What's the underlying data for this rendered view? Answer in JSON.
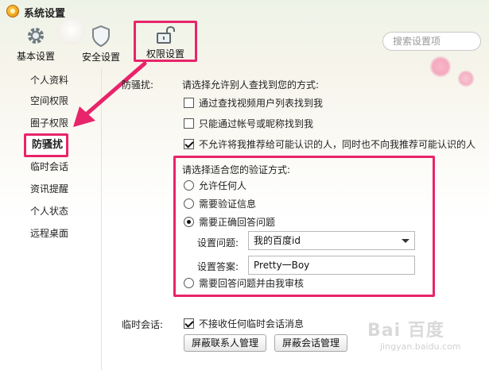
{
  "window": {
    "title": "系统设置"
  },
  "toolbar": {
    "basic_label": "基本设置",
    "security_label": "安全设置",
    "permission_label": "权限设置"
  },
  "search": {
    "placeholder": "搜索设置项"
  },
  "sidebar": {
    "items": [
      {
        "label": "个人资料"
      },
      {
        "label": "空间权限"
      },
      {
        "label": "圈子权限"
      },
      {
        "label": "防骚扰"
      },
      {
        "label": "临时会话"
      },
      {
        "label": "资讯提醒"
      },
      {
        "label": "个人状态"
      },
      {
        "label": "远程桌面"
      }
    ]
  },
  "anti_harass": {
    "section_label": "防骚扰:",
    "prompt": "请选择允许别人查找到您的方式:",
    "options": [
      {
        "label": "通过查找视频用户列表找到我",
        "checked": false
      },
      {
        "label": "只能通过帐号或昵称找到我",
        "checked": false
      },
      {
        "label": "不允许将我推荐给可能认识的人，同时也不向我推荐可能认识的人",
        "checked": true
      }
    ],
    "verify_prompt": "请选择适合您的验证方式:",
    "verify_options": [
      {
        "label": "允许任何人",
        "checked": false
      },
      {
        "label": "需要验证信息",
        "checked": false
      },
      {
        "label": "需要正确回答问题",
        "checked": true
      },
      {
        "label": "需要回答问题并由我审核",
        "checked": false
      }
    ],
    "question_label": "设置问题:",
    "question_value": "我的百度id",
    "answer_label": "设置答案:",
    "answer_value": "Pretty一Boy"
  },
  "temp_session": {
    "section_label": "临时会话:",
    "option_label": "不接收任何临时会话消息",
    "option_checked": true,
    "block_contacts_button": "屏蔽联系人管理",
    "block_session_button": "屏蔽会话管理"
  },
  "colors": {
    "highlight": "#e8246a"
  },
  "watermark": {
    "text": "Bai 百度",
    "sub": "jingyan.baidu.com"
  }
}
